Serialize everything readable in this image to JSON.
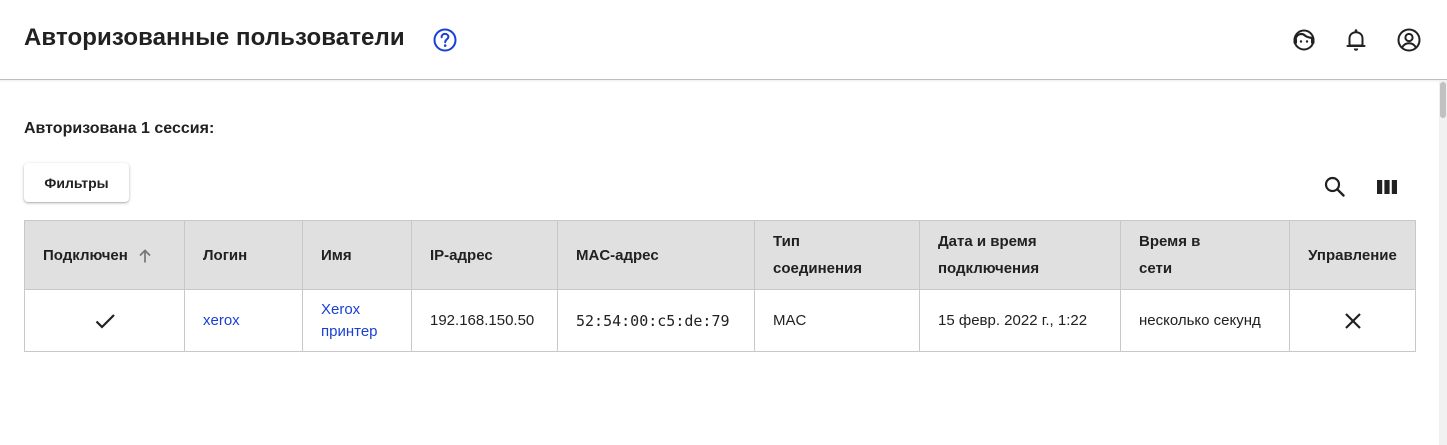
{
  "header": {
    "title": "Авторизованные пользователи",
    "icons": [
      "help-icon",
      "support-icon",
      "bell-icon",
      "account-icon"
    ]
  },
  "main": {
    "session_count": "Авторизована 1 сессия:",
    "filters_label": "Фильтры",
    "toolbar_icons": [
      "search-icon",
      "columns-icon"
    ]
  },
  "table": {
    "columns": [
      {
        "line1": "Подключен",
        "line2": ""
      },
      {
        "line1": "Логин",
        "line2": ""
      },
      {
        "line1": "Имя",
        "line2": ""
      },
      {
        "line1": "IP-адрес",
        "line2": ""
      },
      {
        "line1": "MAC-адрес",
        "line2": ""
      },
      {
        "line1": "Тип",
        "line2": "соединения"
      },
      {
        "line1": "Дата и время",
        "line2": "подключения"
      },
      {
        "line1": "Время в",
        "line2": "сети"
      },
      {
        "line1": "Управление",
        "line2": ""
      }
    ],
    "sort_column": "Подключен",
    "sort_direction": "ascending",
    "rows": [
      {
        "connected": true,
        "login": "xerox",
        "name_line1": "Xerox",
        "name_line2": "принтер",
        "ip": "192.168.150.50",
        "mac": "52:54:00:c5:de:79",
        "connection_type": "MAC",
        "connected_at": "15 февр. 2022 г., 1:22",
        "online_time": "несколько секунд"
      }
    ]
  },
  "colors": {
    "accent": "#1a3fd6",
    "header_bg": "#e0e0e0",
    "border": "#c8c8c8"
  }
}
